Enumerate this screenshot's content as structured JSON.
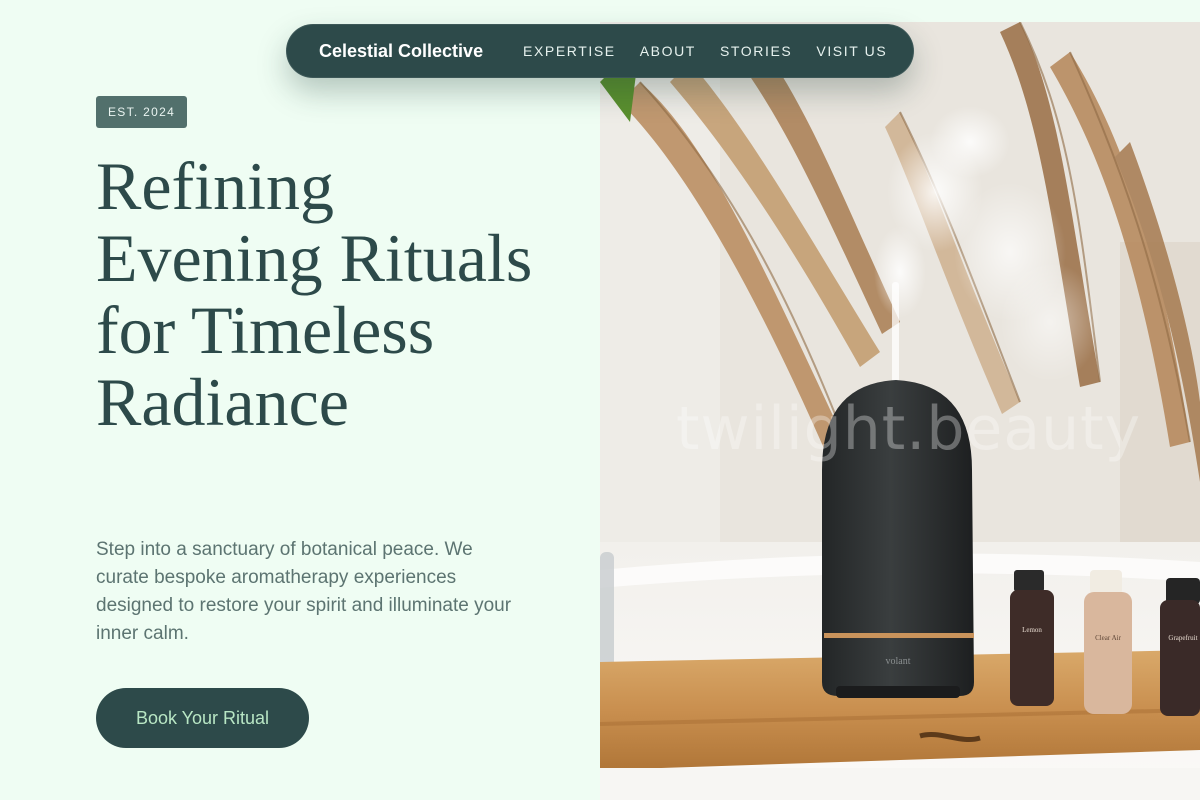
{
  "nav": {
    "brand": "Celestial Collective",
    "links": [
      "EXPERTISE",
      "ABOUT",
      "STORIES",
      "VISIT US"
    ]
  },
  "hero": {
    "badge": "EST. 2024",
    "headline": "Refining Evening Rituals for Timeless Radiance",
    "intro": "Step into a sanctuary of botanical peace. We curate bespoke aromatherapy experiences designed to restore your spirit and illuminate your inner calm.",
    "cta_label": "Book Your Ritual"
  },
  "photo": {
    "watermark": "twilight.beauty",
    "diffuser_brand": "volant",
    "bottle_labels": [
      "Lemon",
      "Clear Air",
      "Grapefruit"
    ]
  },
  "colors": {
    "page_bg": "#effdf3",
    "primary": "#2d4a4a",
    "badge_bg": "#52706c",
    "body_text": "#5c7471",
    "cta_text": "#b8e6c4"
  }
}
